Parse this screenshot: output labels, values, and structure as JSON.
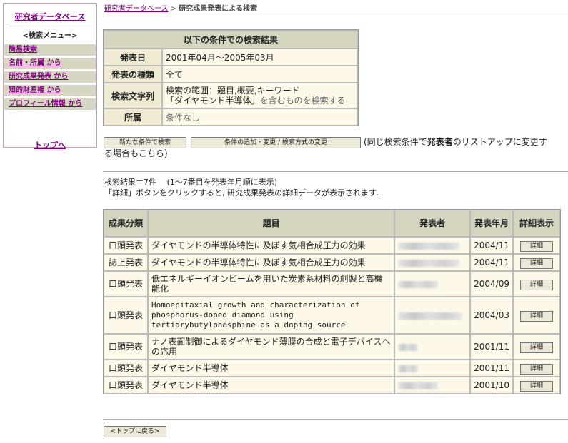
{
  "sidebar": {
    "db_link": "研究者データベース",
    "menu_title": "<検索メニュー>",
    "items": [
      {
        "label": "簡易検索"
      },
      {
        "label": "名前・所属 から"
      },
      {
        "label": "研究成果発表 から"
      },
      {
        "label": "知的財産権 から"
      },
      {
        "label": "プロフィール情報 から"
      }
    ],
    "top_link": "トップへ"
  },
  "breadcrumb": {
    "root": "研究者データベース",
    "separator": " > ",
    "current": "研究成果発表による検索"
  },
  "conditions": {
    "title": "以下の条件での検索結果",
    "rows": [
      {
        "label": "発表日",
        "value": "2001年04月～2005年03月"
      },
      {
        "label": "発表の種類",
        "value": "全て"
      },
      {
        "label": "検索文字列",
        "line1": "検索の範囲：題目,概要,キーワード",
        "line2_keyword": "「ダイヤモンド半導体」",
        "line2_rest": "を含むものを検索する"
      },
      {
        "label": "所属",
        "value": "条件なし"
      }
    ]
  },
  "buttons": {
    "new_search": "新たな条件で検索",
    "modify_search": "条件の追加・変更 / 検索方式の変更",
    "back_top": "<トップに戻る>"
  },
  "note": {
    "part1": "(同じ検索条件で",
    "bold": "発表者",
    "part2": "のリストアップに変更す",
    "line2": "る場合もこちら)"
  },
  "results_info": {
    "count": "検索結果＝7件　 (1～7番目を発表年月順に表示)",
    "hint": "「詳細」ボタンをクリックすると, 研究成果発表の詳細データが表示されます."
  },
  "results": {
    "headers": {
      "type": "成果分類",
      "title": "題目",
      "author": "発表者",
      "year": "発表年月",
      "detail": "詳細表示"
    },
    "detail_label": "詳細",
    "rows": [
      {
        "type": "口頭発表",
        "title": "ダイヤモンドの半導体特性に及ぼす気相合成圧力の効果",
        "year": "2004/11"
      },
      {
        "type": "誌上発表",
        "title": "ダイヤモンドの半導体特性に及ぼす気相合成圧力の効果",
        "year": "2004/11"
      },
      {
        "type": "口頭発表",
        "title": "低エネルギーイオンビームを用いた炭素系材料の創製と高機能化",
        "year": "2004/09"
      },
      {
        "type": "口頭発表",
        "title": "Homoepitaxial growth and characterization of phosphorus-doped diamond using tertiarybutylphosphine as a doping source",
        "year": "2004/03"
      },
      {
        "type": "口頭発表",
        "title": "ナノ表面制御によるダイヤモンド薄膜の合成と電子デバイスへの応用",
        "year": "2001/11"
      },
      {
        "type": "口頭発表",
        "title": "ダイヤモンド半導体",
        "year": "2001/11"
      },
      {
        "type": "口頭発表",
        "title": "ダイヤモンド半導体",
        "year": "2001/10"
      }
    ]
  }
}
